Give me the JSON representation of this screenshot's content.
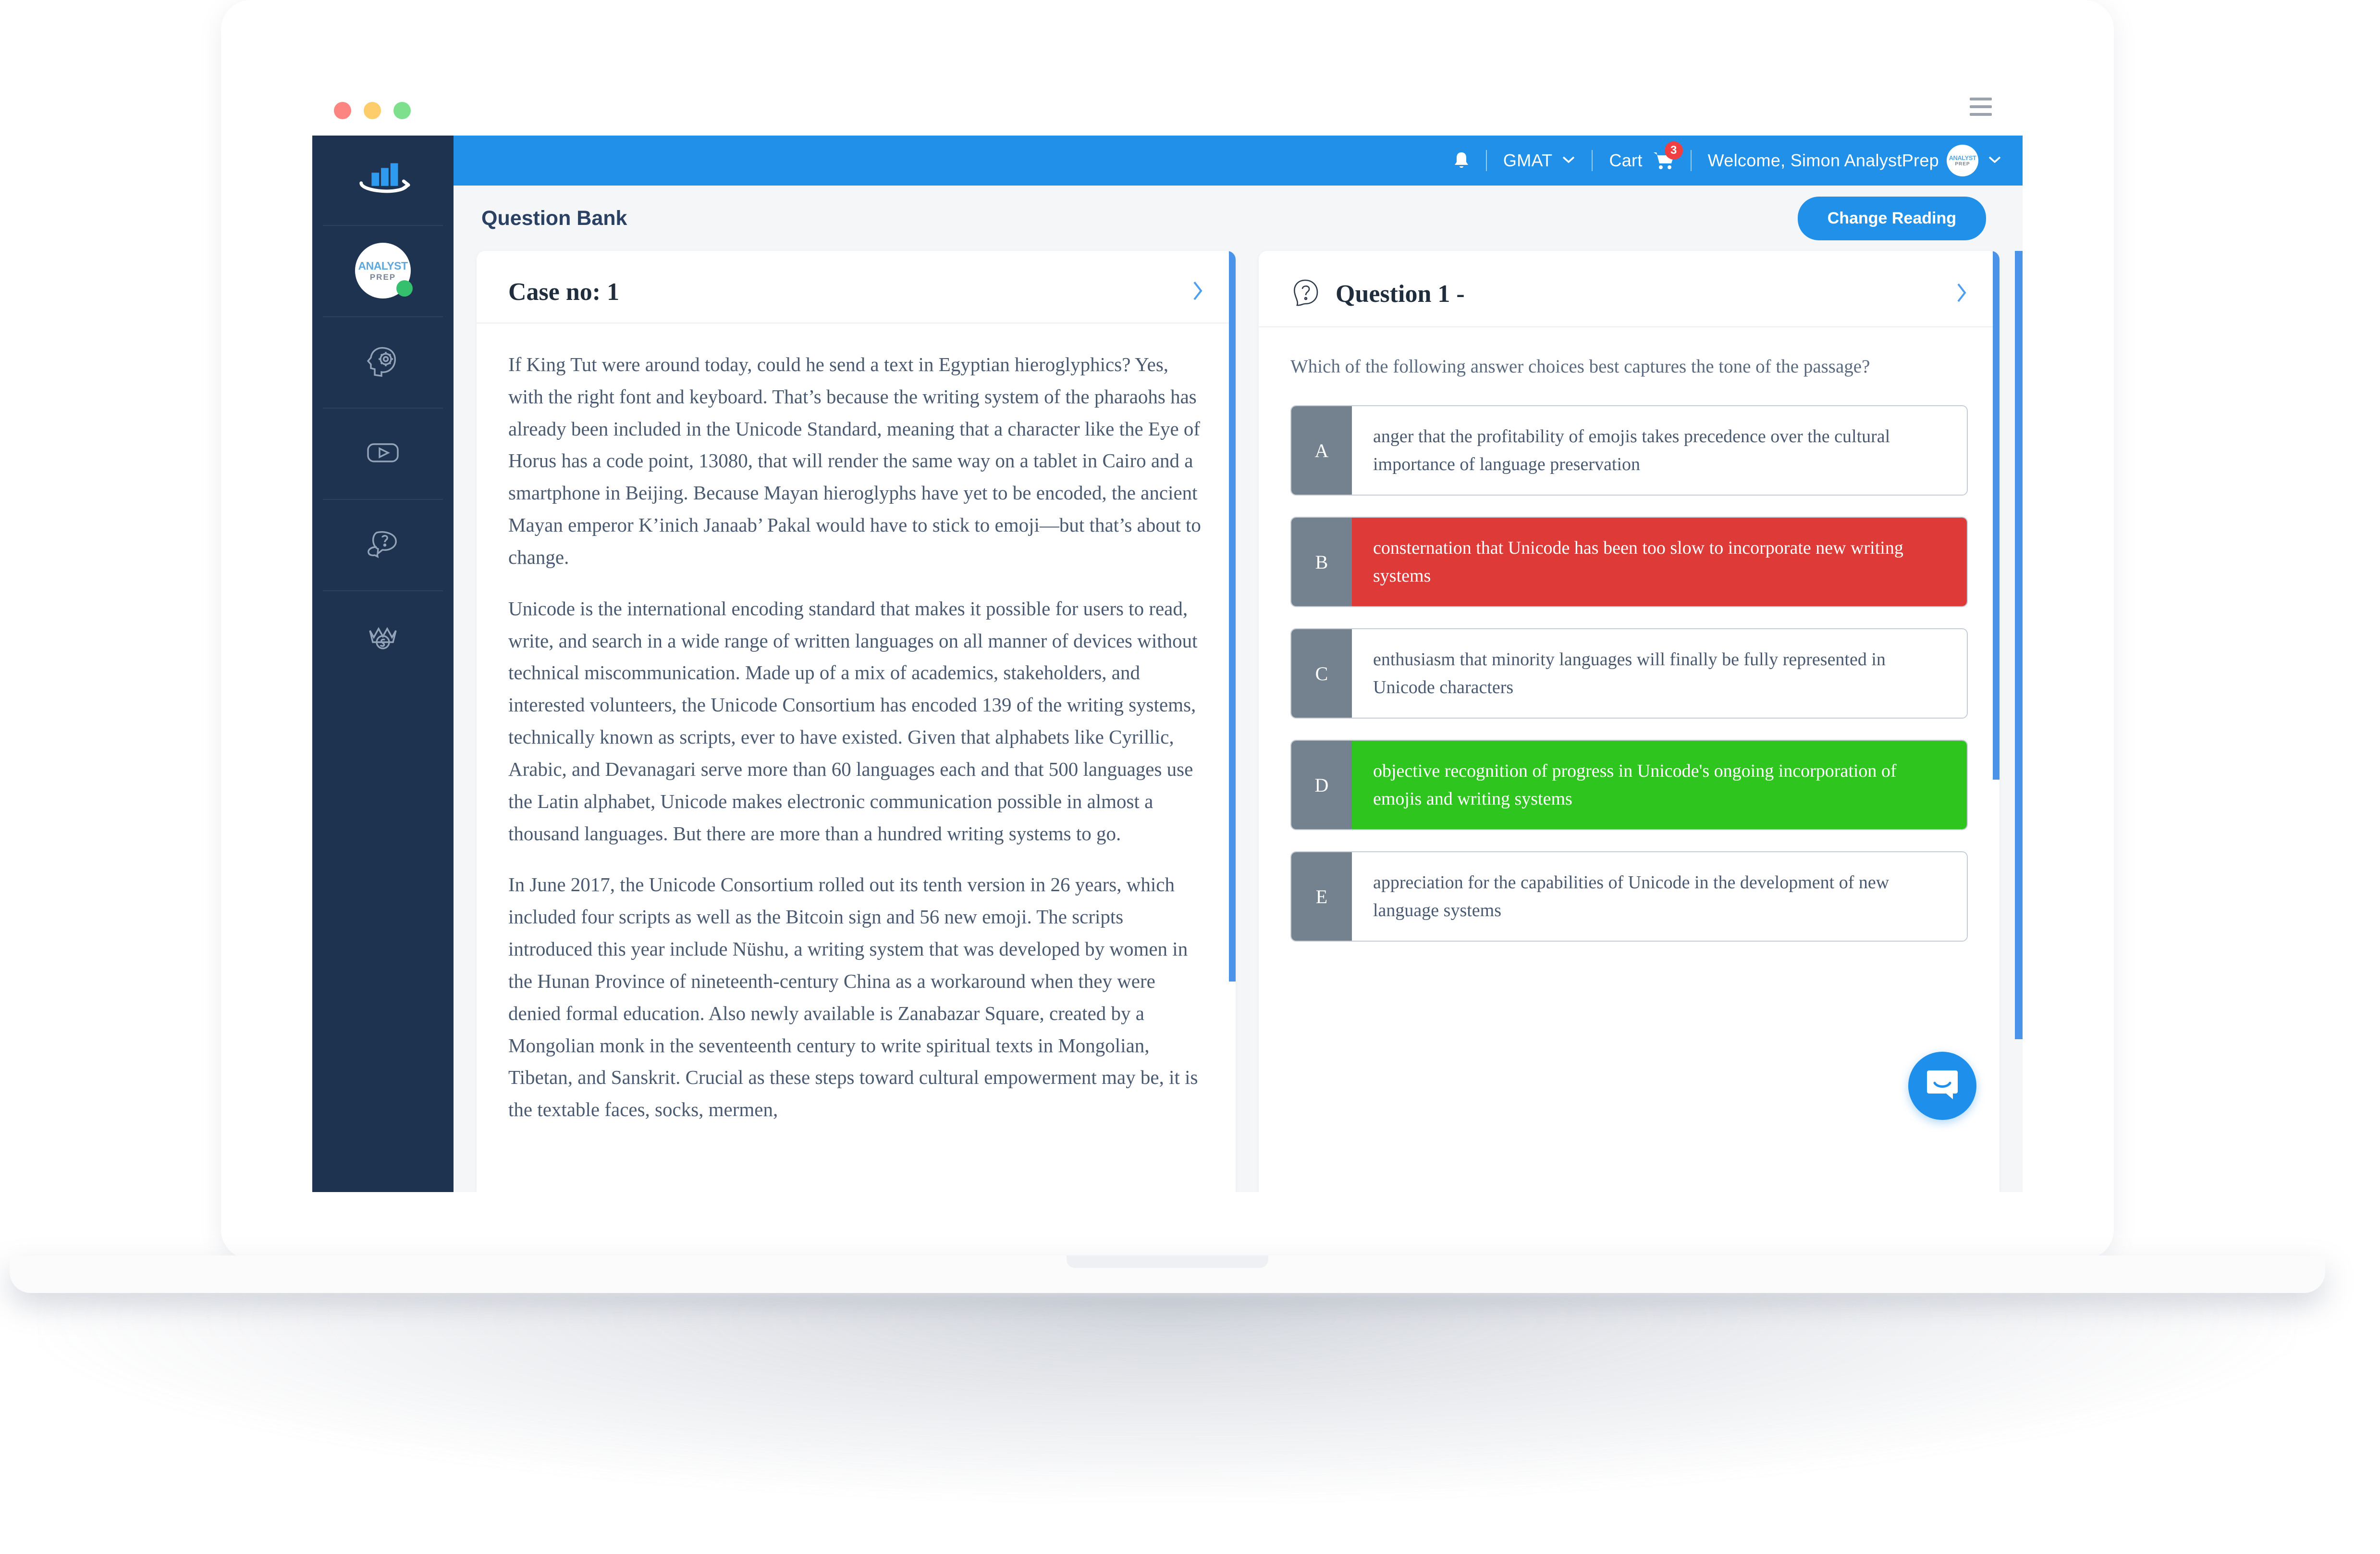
{
  "browser": {
    "traffic_lights": [
      "close",
      "minimize",
      "maximize"
    ],
    "menu_icon": "hamburger-icon"
  },
  "sidebar": {
    "items": [
      {
        "icon": "bar-chart-logo-icon",
        "label": "Dashboard logo"
      },
      {
        "icon": "user-avatar-icon",
        "label": "AnalystPrep",
        "avatar_top": "ANALYST",
        "avatar_bottom": "PREP",
        "status": "online"
      },
      {
        "icon": "brain-gear-icon",
        "label": "Learn"
      },
      {
        "icon": "video-play-icon",
        "label": "Videos"
      },
      {
        "icon": "question-bubble-icon",
        "label": "Question Bank"
      },
      {
        "icon": "crown-s-icon",
        "label": "Premium"
      }
    ]
  },
  "topnav": {
    "bell_icon": "notification-bell-icon",
    "exam": "GMAT",
    "exam_caret": "chevron-down-icon",
    "cart_label": "Cart",
    "cart_icon": "shopping-cart-icon",
    "cart_count": "3",
    "welcome": "Welcome, Simon AnalystPrep",
    "avatar_top": "ANALYST",
    "avatar_bottom": "PREP",
    "user_caret": "chevron-down-icon",
    "bg_color": "#2190e8"
  },
  "header": {
    "title": "Question Bank",
    "change_reading_label": "Change Reading",
    "button_color": "#2190e8"
  },
  "case_panel": {
    "title": "Case no: 1",
    "expand_icon": "chevron-right-icon",
    "paragraphs": [
      "If King Tut were around today, could he send a text in Egyptian hieroglyphics? Yes, with the right font and keyboard. That’s because the writing system of the pharaohs has already been included in the Unicode Standard, meaning that a character like the Eye of Horus has a code point, 13080, that will render the same way on a tablet in Cairo and a smartphone in Beijing. Because Mayan hieroglyphs have yet to be encoded, the ancient Mayan emperor K’inich Janaab’ Pakal would have to stick to emoji—but that’s about to change.",
      "Unicode is the international encoding standard that makes it possible for users to read, write, and search in a wide range of written languages on all manner of devices without technical miscommunication. Made up of a mix of academics, stakeholders, and interested volunteers, the Unicode Consortium has encoded 139 of the writing systems, technically known as scripts, ever to have existed. Given that alphabets like Cyrillic, Arabic, and Devanagari serve more than 60 languages each and that 500 languages use the Latin alphabet, Unicode makes electronic communication possible in almost a thousand languages. But there are more than a hundred writing systems to go.",
      "In June 2017, the Unicode Consortium rolled out its tenth version in 26 years, which included four scripts as well as the Bitcoin sign and 56 new emoji. The scripts introduced this year include Nüshu, a writing system that was developed by women in the Hunan Province of nineteenth-century China as a workaround when they were denied formal education. Also newly available is Zanabazar Square, created by a Mongolian monk in the seventeenth century to write spiritual texts in Mongolian, Tibetan, and Sanskrit. Crucial as these steps toward cultural empowerment may be, it is the textable faces, socks, mermen,"
    ]
  },
  "question_panel": {
    "icon": "question-bubble-icon",
    "title": "Question 1 -",
    "expand_icon": "chevron-right-icon",
    "prompt": "Which of the following answer choices best captures the tone of the passage?",
    "choices": [
      {
        "letter": "A",
        "text": "anger that the profitability of emojis takes precedence over the cultural importance of language preservation",
        "state": "default"
      },
      {
        "letter": "B",
        "text": "consternation that Unicode has been too slow to incorporate new writing systems",
        "state": "wrong"
      },
      {
        "letter": "C",
        "text": "enthusiasm that minority languages will finally be fully represented in Unicode characters",
        "state": "default"
      },
      {
        "letter": "D",
        "text": "objective recognition of progress in Unicode's ongoing incorporation of emojis and writing systems",
        "state": "correct"
      },
      {
        "letter": "E",
        "text": "appreciation for the capabilities of Unicode in the development of new language systems",
        "state": "default"
      }
    ],
    "wrong_color": "#dd3a38",
    "correct_color": "#2ec51f",
    "letter_box_color": "#74828f"
  },
  "chat_widget": {
    "icon": "intercom-chat-icon",
    "color": "#1f8fec"
  }
}
